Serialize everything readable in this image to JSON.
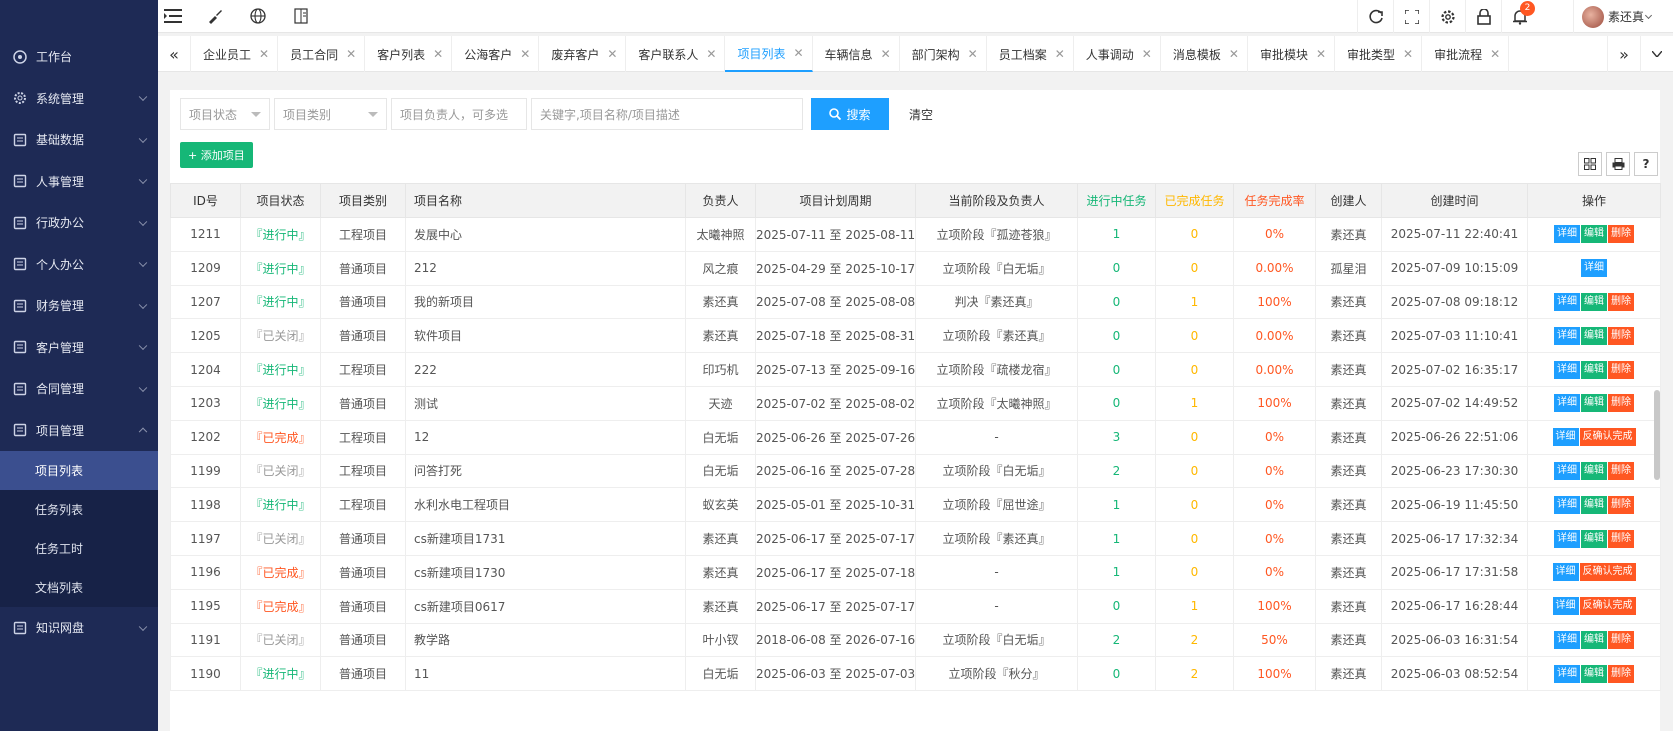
{
  "sidebar": {
    "items": [
      {
        "label": "工作台",
        "icon": "dashboard-icon"
      },
      {
        "label": "系统管理",
        "icon": "gear-icon"
      },
      {
        "label": "基础数据",
        "icon": "database-icon"
      },
      {
        "label": "人事管理",
        "icon": "person-icon"
      },
      {
        "label": "行政办公",
        "icon": "office-icon"
      },
      {
        "label": "个人办公",
        "icon": "user-doc-icon"
      },
      {
        "label": "财务管理",
        "icon": "finance-icon"
      },
      {
        "label": "客户管理",
        "icon": "customer-icon"
      },
      {
        "label": "合同管理",
        "icon": "contract-icon"
      },
      {
        "label": "项目管理",
        "icon": "folder-icon"
      }
    ],
    "sub_items": [
      "项目列表",
      "任务列表",
      "任务工时",
      "文档列表"
    ],
    "last_item": {
      "label": "知识网盘",
      "icon": "cloud-disk-icon"
    }
  },
  "topbar": {
    "notification_count": "2",
    "user_name": "素还真"
  },
  "tabs": [
    "企业员工",
    "员工合同",
    "客户列表",
    "公海客户",
    "废弃客户",
    "客户联系人",
    "项目列表",
    "车辆信息",
    "部门架构",
    "员工档案",
    "人事调动",
    "消息模板",
    "审批模块",
    "审批类型",
    "审批流程"
  ],
  "active_tab": "项目列表",
  "search": {
    "status_placeholder": "项目状态",
    "type_placeholder": "项目类别",
    "owner_placeholder": "项目负责人，可多选",
    "keyword_placeholder": "关键字,项目名称/项目描述",
    "search_label": "搜索",
    "clear_label": "清空"
  },
  "toolbar": {
    "add_label": "+ 添加项目"
  },
  "table": {
    "headers": [
      "ID号",
      "项目状态",
      "项目类别",
      "项目名称",
      "负责人",
      "项目计划周期",
      "当前阶段及负责人",
      "进行中任务",
      "已完成任务",
      "任务完成率",
      "创建人",
      "创建时间",
      "操作"
    ],
    "rows": [
      [
        "1211",
        "『进行中』",
        "工程项目",
        "发展中心",
        "太曦神照",
        "2025-07-11 至 2025-08-11",
        "立项阶段『孤迹苍狼』",
        "1",
        "0",
        "0%",
        "素还真",
        "2025-07-11 22:40:41",
        "run"
      ],
      [
        "1209",
        "『进行中』",
        "普通项目",
        "212",
        "风之痕",
        "2025-04-29 至 2025-10-17",
        "立项阶段『白无垢』",
        "0",
        "0",
        "0.00%",
        "孤星泪",
        "2025-07-09 10:15:09",
        "view"
      ],
      [
        "1207",
        "『进行中』",
        "普通项目",
        "我的新项目",
        "素还真",
        "2025-07-08 至 2025-08-08",
        "判决『素还真』",
        "0",
        "1",
        "100%",
        "素还真",
        "2025-07-08 09:18:12",
        "run"
      ],
      [
        "1205",
        "『已关闭』",
        "普通项目",
        "软件项目",
        "素还真",
        "2025-07-18 至 2025-08-31",
        "立项阶段『素还真』",
        "0",
        "0",
        "0.00%",
        "素还真",
        "2025-07-03 11:10:41",
        "closed"
      ],
      [
        "1204",
        "『进行中』",
        "工程项目",
        "222",
        "印巧机",
        "2025-07-13 至 2025-09-16",
        "立项阶段『疏楼龙宿』",
        "0",
        "0",
        "0.00%",
        "素还真",
        "2025-07-02 16:35:17",
        "run"
      ],
      [
        "1203",
        "『进行中』",
        "普通项目",
        "测试",
        "天迹",
        "2025-07-02 至 2025-08-02",
        "立项阶段『太曦神照』",
        "0",
        "1",
        "100%",
        "素还真",
        "2025-07-02 14:49:52",
        "run"
      ],
      [
        "1202",
        "『已完成』",
        "工程项目",
        "12",
        "白无垢",
        "2025-06-26 至 2025-07-26",
        "-",
        "3",
        "0",
        "0%",
        "素还真",
        "2025-06-26 22:51:06",
        "done"
      ],
      [
        "1199",
        "『已关闭』",
        "工程项目",
        "问答打死",
        "白无垢",
        "2025-06-16 至 2025-07-28",
        "立项阶段『白无垢』",
        "2",
        "0",
        "0%",
        "素还真",
        "2025-06-23 17:30:30",
        "closed"
      ],
      [
        "1198",
        "『进行中』",
        "工程项目",
        "水利水电工程项目",
        "蚁玄英",
        "2025-05-01 至 2025-10-31",
        "立项阶段『屈世途』",
        "1",
        "0",
        "0%",
        "素还真",
        "2025-06-19 11:45:50",
        "run"
      ],
      [
        "1197",
        "『已关闭』",
        "普通项目",
        "cs新建项目1731",
        "素还真",
        "2025-06-17 至 2025-07-17",
        "立项阶段『素还真』",
        "1",
        "0",
        "0%",
        "素还真",
        "2025-06-17 17:32:34",
        "closed"
      ],
      [
        "1196",
        "『已完成』",
        "普通项目",
        "cs新建项目1730",
        "素还真",
        "2025-06-17 至 2025-07-18",
        "-",
        "1",
        "0",
        "0%",
        "素还真",
        "2025-06-17 17:31:58",
        "done"
      ],
      [
        "1195",
        "『已完成』",
        "普通项目",
        "cs新建项目0617",
        "素还真",
        "2025-06-17 至 2025-07-17",
        "-",
        "0",
        "1",
        "100%",
        "素还真",
        "2025-06-17 16:28:44",
        "done"
      ],
      [
        "1191",
        "『已关闭』",
        "普通项目",
        "教学路",
        "叶小钗",
        "2018-06-08 至 2026-07-16",
        "立项阶段『白无垢』",
        "2",
        "2",
        "50%",
        "素还真",
        "2025-06-03 16:31:54",
        "closed"
      ],
      [
        "1190",
        "『进行中』",
        "普通项目",
        "11",
        "白无垢",
        "2025-06-03 至 2025-07-03",
        "立项阶段『秋分』",
        "0",
        "2",
        "100%",
        "素还真",
        "2025-06-03 08:52:54",
        "run"
      ]
    ],
    "ops": {
      "view": "详细",
      "edit": "编辑",
      "delete": "删除",
      "unconfirm": "反确认完成"
    }
  },
  "colors": {
    "primary": "#1e9fff",
    "success": "#16b777",
    "danger": "#ff5722",
    "warn": "#ffb800",
    "sidebar": "#1e2a55"
  }
}
